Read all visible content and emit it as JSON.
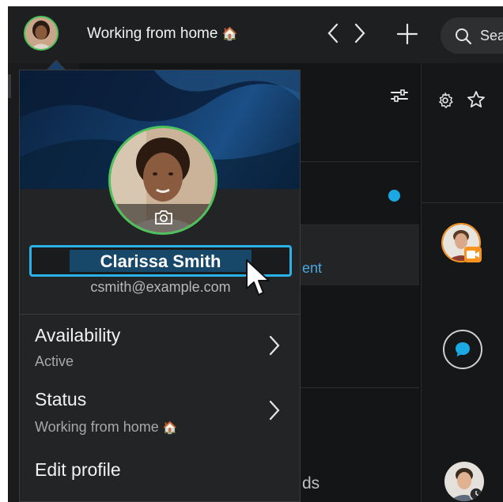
{
  "header": {
    "status_text": "Working from home",
    "status_emoji": "🏠",
    "search_placeholder": "Sea"
  },
  "background": {
    "peek_link": "ent",
    "peek_text": "ds"
  },
  "profile": {
    "name": "Clarissa Smith",
    "email": "csmith@example.com",
    "availability_label": "Availability",
    "availability_value": "Active",
    "status_label": "Status",
    "status_value": "Working from home",
    "status_emoji": "🏠",
    "edit_label": "Edit profile"
  },
  "colors": {
    "presence_green": "#4cc35a",
    "focus_blue": "#2bb2e6",
    "accent_blue": "#1ba9e6",
    "video_orange": "#f7931e"
  }
}
